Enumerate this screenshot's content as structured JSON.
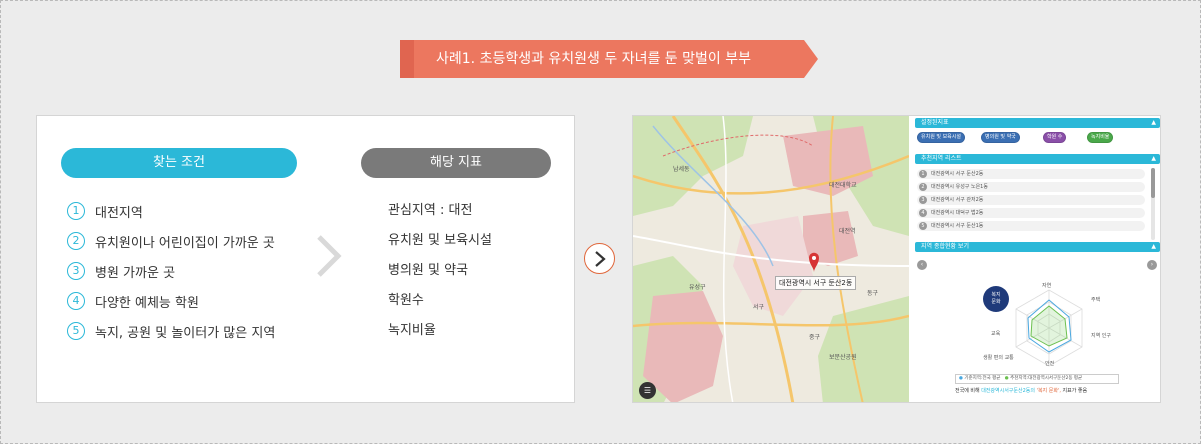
{
  "title": "사례1. 초등학생과 유치원생 두 자녀를 둔 맞벌이 부부",
  "conditions": {
    "label": "찾는 조건",
    "items": [
      {
        "num": "1",
        "text": "대전지역"
      },
      {
        "num": "2",
        "text": "유치원이나 어린이집이 가까운 곳"
      },
      {
        "num": "3",
        "text": "병원 가까운 곳"
      },
      {
        "num": "4",
        "text": "다양한 예체능 학원"
      },
      {
        "num": "5",
        "text": "녹지, 공원 및 놀이터가 많은 지역"
      }
    ]
  },
  "indicators": {
    "label": "해당 지표",
    "items": [
      "관심지역 : 대전",
      "유치원 및 보육시설",
      "병의원 및 약국",
      "학원수",
      "녹지비율"
    ]
  },
  "screenshot": {
    "map_label": "대전광역시 서구 둔산2동",
    "map_places": [
      "남세동",
      "대전대학교",
      "대전역",
      "유성구",
      "서구",
      "동구",
      "중구",
      "보문산공원"
    ],
    "settings": {
      "title": "설정된지표",
      "chips": [
        "유치원 및 보육시설",
        "병의원 및 약국",
        "학원 수",
        "녹지비율"
      ]
    },
    "recommend": {
      "title": "추천지역 리스트",
      "rows": [
        {
          "num": "1",
          "text": "대전광역시 서구 둔산2동"
        },
        {
          "num": "2",
          "text": "대전광역시 유성구 노은1동"
        },
        {
          "num": "3",
          "text": "대전광역시 서구 관저2동"
        },
        {
          "num": "4",
          "text": "대전광역시 대덕구 법2동"
        },
        {
          "num": "5",
          "text": "대전광역시 서구 둔산1동"
        }
      ]
    },
    "overview": {
      "title": "지역 종합현황 보기",
      "badge_line1": "복지",
      "badge_line2": "문화",
      "axes": [
        "자연",
        "주택",
        "지역 인구",
        "안전",
        "생활 편의 교통",
        "교육"
      ],
      "legend": [
        "기준지역:전국 평균",
        "추천지역:대전광역시서구둔산2동 평균"
      ],
      "summary_pre": "전국에 비해 ",
      "summary_region": "대전광역시서구둔산2동의",
      "summary_mid": " '복지 문화',",
      "summary_post": " 지표가 좋음"
    }
  },
  "colors": {
    "accent": "#2bb8d8",
    "ribbon": "#f0826b",
    "gray_pill": "#7a7a7a"
  }
}
